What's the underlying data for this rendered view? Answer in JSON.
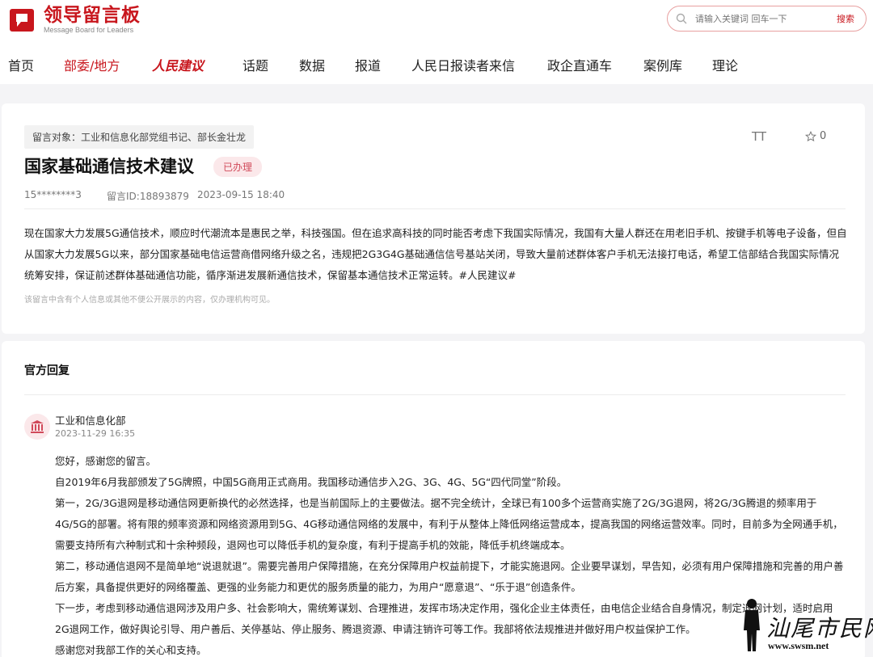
{
  "header": {
    "logo_title": "领导留言板",
    "logo_subtitle": "Message Board for Leaders",
    "search_placeholder": "请输入关键词 回车一下",
    "search_button": "搜索"
  },
  "nav": {
    "items": [
      "首页",
      "部委/地方",
      "人民建议",
      "话题",
      "数据",
      "报道",
      "人民日报读者来信",
      "政企直通车",
      "案例库",
      "理论"
    ],
    "active_index": 1
  },
  "message": {
    "target": "留言对象：工业和信息化部党组书记、部长金壮龙",
    "font_toggle": "TT",
    "favorites": "0",
    "title": "国家基础通信技术建议",
    "status": "已办理",
    "author": "15********3",
    "message_id": "留言ID:18893879",
    "date": "2023-09-15 18:40",
    "content": "现在国家大力发展5G通信技术，顺应时代潮流本是惠民之举，科技强国。但在追求高科技的同时能否考虑下我国实际情况，我国有大量人群还在用老旧手机、按键手机等电子设备，但自从国家大力发展5G以来，部分国家基础电信运营商借网络升级之名，违规把2G3G4G基础通信信号基站关闭，导致大量前述群体客户手机无法接打电话，希望工信部结合我国实际情况统筹安排，保证前述群体基础通信功能，循序渐进发展新通信技术，保留基本通信技术正常运转。#人民建议#",
    "privacy_note": "该留言中含有个人信息或其他不便公开展示的内容，仅办理机构可见。"
  },
  "reply": {
    "section_title": "官方回复",
    "department": "工业和信息化部",
    "date": "2023-11-29 16:35",
    "paragraphs": [
      "您好，感谢您的留言。",
      "自2019年6月我部颁发了5G牌照，中国5G商用正式商用。我国移动通信步入2G、3G、4G、5G“四代同堂”阶段。",
      "第一，2G/3G退网是移动通信网更新换代的必然选择，也是当前国际上的主要做法。据不完全统计，全球已有100多个运营商实施了2G/3G退网，将2G/3G腾退的频率用于4G/5G的部署。将有限的频率资源和网络资源用到5G、4G移动通信网络的发展中，有利于从整体上降低网络运营成本，提高我国的网络运营效率。同时，目前多为全网通手机，需要支持所有六种制式和十余种频段，退网也可以降低手机的复杂度，有利于提高手机的效能，降低手机终端成本。",
      "第二，移动通信退网不是简单地“说退就退”。需要完善用户保障措施，在充分保障用户权益前提下，才能实施退网。企业要早谋划，早告知，必须有用户保障措施和完善的用户善后方案，具备提供更好的网络覆盖、更强的业务能力和更优的服务质量的能力，为用户“愿意退”、“乐于退”创造条件。",
      "下一步，考虑到移动通信退网涉及用户多、社会影响大，需统筹谋划、合理推进，发挥市场决定作用，强化企业主体责任，由电信企业结合自身情况，制定退网计划，适时启用2G退网工作，做好舆论引导、用户善后、关停基站、停止服务、腾退资源、申请注销许可等工作。我部将依法规推进并做好用户权益保护工作。",
      "感谢您对我部工作的关心和支持。"
    ]
  },
  "watermark": {
    "text": "汕尾市民网",
    "url": "www.swsm.net"
  },
  "colors": {
    "brand_red": "#c8161d",
    "badge_bg": "#fbe8ea",
    "badge_text": "#d14a5a"
  },
  "icons": [
    "logo-icon",
    "search-icon",
    "star-icon",
    "government-building-icon"
  ]
}
